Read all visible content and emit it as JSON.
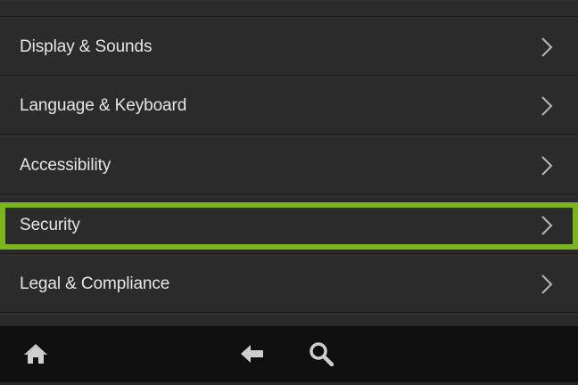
{
  "settings": {
    "items": [
      {
        "label": "Display & Sounds"
      },
      {
        "label": "Language & Keyboard"
      },
      {
        "label": "Accessibility"
      },
      {
        "label": "Security"
      },
      {
        "label": "Legal & Compliance"
      }
    ],
    "selected_index": 3
  },
  "nav": {
    "icons": [
      "home-icon",
      "back-arrow-icon",
      "search-icon"
    ]
  },
  "colors": {
    "highlight": "#7ab51d",
    "row_background": "#2b2b2b",
    "nav_background": "#0f0f0f",
    "text": "#e6e6e6",
    "icon": "#cfcfcf"
  }
}
